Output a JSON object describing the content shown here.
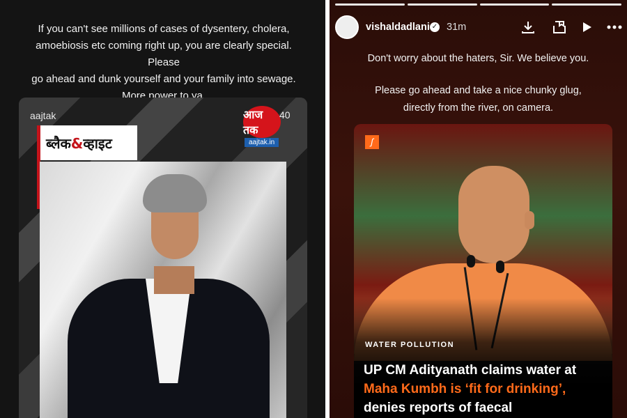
{
  "left_post": {
    "caption_lines": [
      "If you can't see millions of cases of dysentery, cholera,",
      "amoebiosis etc coming right up, you are clearly special.  Please",
      "go ahead and dunk yourself and your family into sewage.",
      "More power to ya."
    ],
    "card": {
      "source": "aajtak",
      "show_logo_part1": "ब्लैक",
      "show_logo_amp": "&",
      "show_logo_part2": "व्हाइट",
      "channel_logo_text": "आज तक",
      "channel_url": "aajtak.in",
      "counter": "40"
    }
  },
  "right_post": {
    "username": "vishaldadlani",
    "time": "31m",
    "icons": [
      "download-icon",
      "save-icon",
      "play-icon",
      "more-icon"
    ],
    "caption_lines": [
      "Don't worry about the haters, Sir. We believe you.",
      "Please go ahead and take a nice chunky glug,",
      "directly from the river, on camera."
    ],
    "article": {
      "kicker": "WATER POLLUTION",
      "headline_part1": "UP CM Adityanath claims water at",
      "headline_highlight": "Maha Kumbh is ‘fit for drinking’,",
      "headline_part2": "denies reports of faecal"
    }
  },
  "colors": {
    "accent_orange": "#ff6a1a",
    "aajtak_red": "#d5141b"
  }
}
